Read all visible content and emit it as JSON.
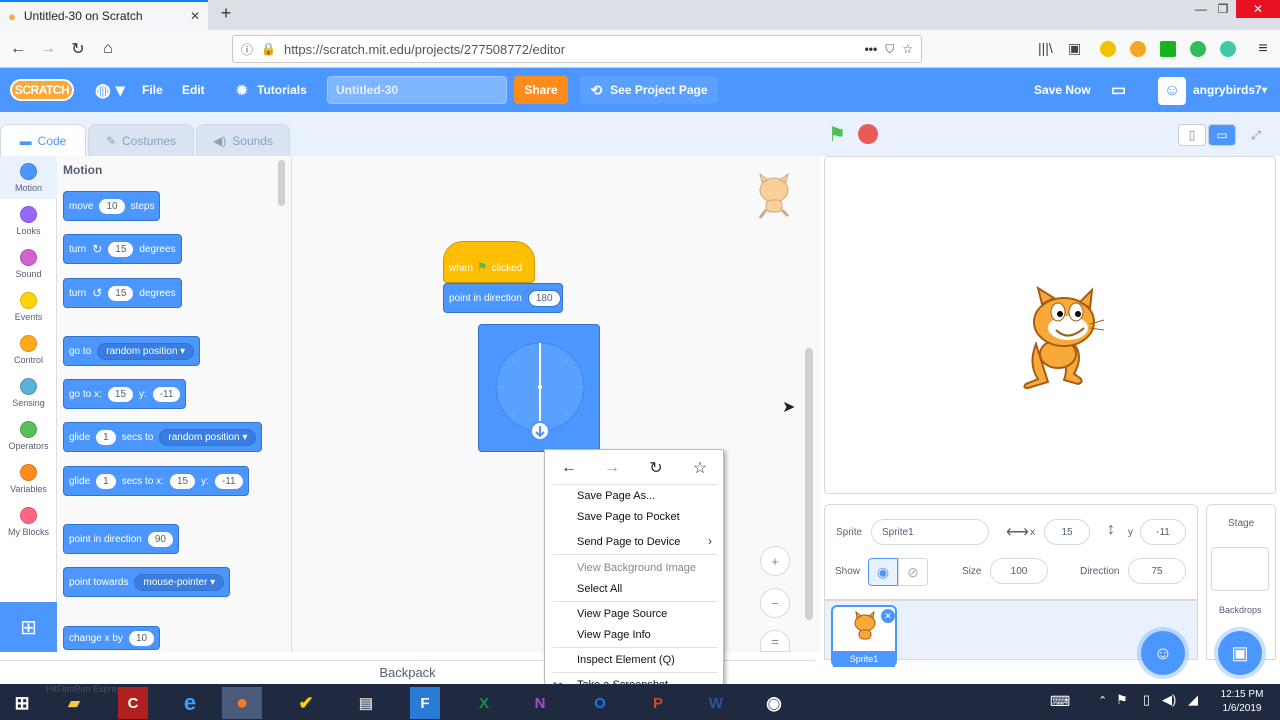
{
  "browser": {
    "tab_title": "Untitled-30 on Scratch",
    "url": "https://scratch.mit.edu/projects/277508772/editor",
    "new_tab": "+",
    "min": "—",
    "max": "❐",
    "close": "✕"
  },
  "menubar": {
    "logo": "SCRATCH",
    "file": "File",
    "edit": "Edit",
    "tutorials": "Tutorials",
    "project_title": "Untitled-30",
    "share": "Share",
    "see_project_page": "See Project Page",
    "save_now": "Save Now",
    "username": "angrybirds7"
  },
  "editor_tabs": {
    "code": "Code",
    "costumes": "Costumes",
    "sounds": "Sounds"
  },
  "categories": [
    {
      "label": "Motion",
      "color": "#4c97ff"
    },
    {
      "label": "Looks",
      "color": "#9966ff"
    },
    {
      "label": "Sound",
      "color": "#cf63cf"
    },
    {
      "label": "Events",
      "color": "#ffd500"
    },
    {
      "label": "Control",
      "color": "#ffab19"
    },
    {
      "label": "Sensing",
      "color": "#5cb1d6"
    },
    {
      "label": "Operators",
      "color": "#59c059"
    },
    {
      "label": "Variables",
      "color": "#ff8c1a"
    },
    {
      "label": "My Blocks",
      "color": "#ff6680"
    }
  ],
  "palette": {
    "heading": "Motion",
    "move": {
      "a": "move",
      "v": "10",
      "b": "steps"
    },
    "turn_r": {
      "a": "turn",
      "v": "15",
      "b": "degrees"
    },
    "turn_l": {
      "a": "turn",
      "v": "15",
      "b": "degrees"
    },
    "goto": {
      "a": "go to",
      "d": "random position"
    },
    "gotoxy": {
      "a": "go to x:",
      "x": "15",
      "ylab": "y:",
      "y": "-11"
    },
    "glide1": {
      "a": "glide",
      "v": "1",
      "b": "secs to",
      "d": "random position"
    },
    "glide2": {
      "a": "glide",
      "v": "1",
      "b": "secs to x:",
      "x": "15",
      "ylab": "y:",
      "y": "-11"
    },
    "point": {
      "a": "point in direction",
      "v": "90"
    },
    "towards": {
      "a": "point towards",
      "d": "mouse-pointer"
    },
    "changex": {
      "a": "change x by",
      "v": "10"
    }
  },
  "script": {
    "hat_a": "when",
    "hat_b": "clicked",
    "point_label": "point in direction",
    "point_value": "180"
  },
  "zoom": {
    "in": "+",
    "out": "−",
    "reset": "="
  },
  "backpack": "Backpack",
  "context_menu": {
    "items": [
      {
        "label": "Save Page As...",
        "disabled": false
      },
      {
        "label": "Save Page to Pocket",
        "disabled": false
      },
      {
        "label": "Send Page to Device",
        "disabled": false
      },
      {
        "label": "View Background Image",
        "disabled": true
      },
      {
        "label": "Select All",
        "disabled": false
      },
      {
        "label": "View Page Source",
        "disabled": false
      },
      {
        "label": "View Page Info",
        "disabled": false
      },
      {
        "label": "Inspect Element (Q)",
        "disabled": false
      },
      {
        "label": "Take a Screenshot",
        "disabled": false
      }
    ],
    "submenu_arrow": "›"
  },
  "sprite_info": {
    "sprite_label": "Sprite",
    "sprite_name": "Sprite1",
    "x_label": "x",
    "x": "15",
    "y_label": "y",
    "y": "-11",
    "show_label": "Show",
    "size_label": "Size",
    "size": "100",
    "direction_label": "Direction",
    "direction": "75"
  },
  "sprite_tile": "Sprite1",
  "stage_pane": {
    "title": "Stage",
    "backdrops": "Backdrops"
  },
  "taskbar": {
    "time": "12:15 PM",
    "date": "1/6/2019",
    "ghost": "HitFilmRun Express"
  },
  "colors": {
    "scratch_blue": "#4c97ff",
    "orange": "#ff8c1a",
    "events_yellow": "#ffbf00"
  }
}
